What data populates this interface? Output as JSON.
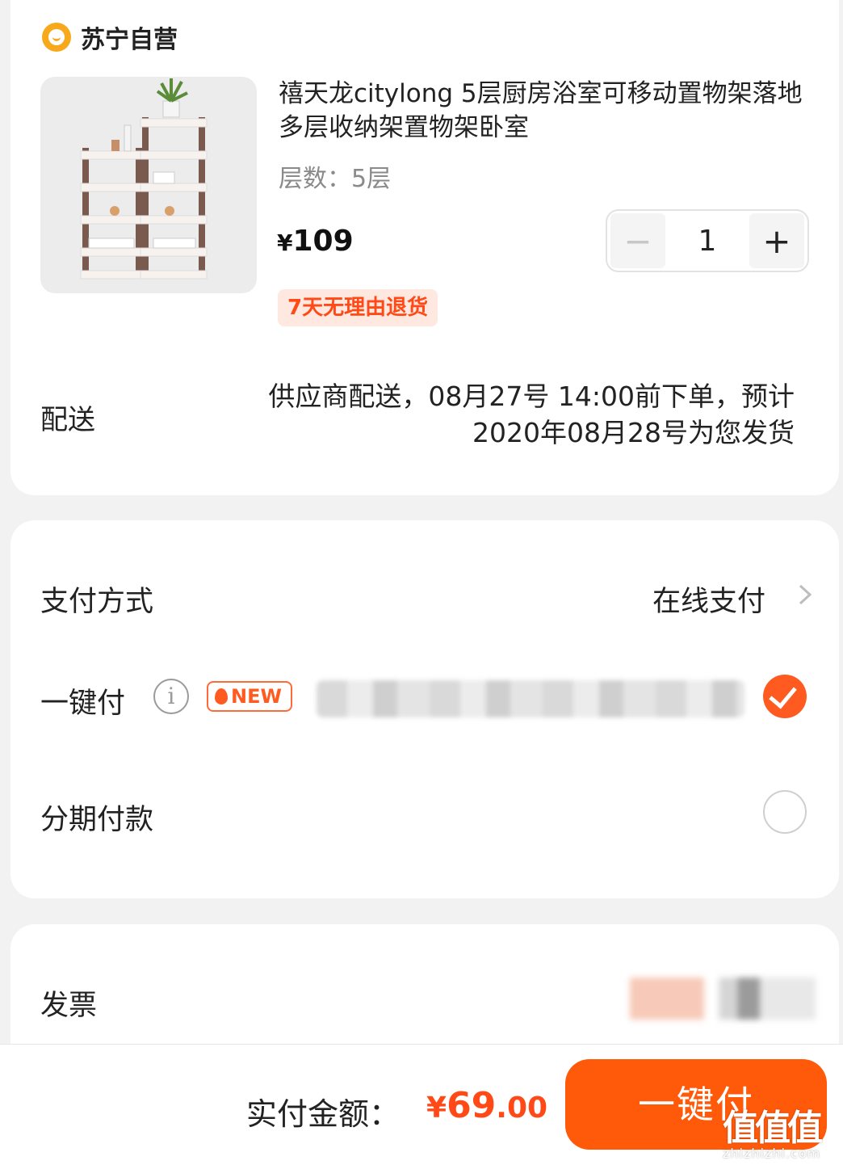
{
  "store": {
    "name": "苏宁自营",
    "logo_icon": "lion-logo-icon"
  },
  "product": {
    "title": "禧天龙citylong 5层厨房浴室可移动置物架落地多层收纳架置物架卧室",
    "spec": "层数：5层",
    "price_symbol": "¥",
    "price": "109",
    "quantity": "1",
    "minus_label": "−",
    "plus_label": "+",
    "return_tag": "7天无理由退货"
  },
  "shipping": {
    "label": "配送",
    "line1": "供应商配送，08月27号 14:00前下单，预计",
    "line2": "2020年08月28号为您发货"
  },
  "payment": {
    "method_label": "支付方式",
    "method_value": "在线支付",
    "onekey_label": "一键付",
    "new_badge": "NEW",
    "onekey_selected": true,
    "installment_label": "分期付款",
    "installment_selected": false
  },
  "invoice": {
    "label": "发票"
  },
  "footer": {
    "total_label": "实付金额：",
    "total_symbol": "¥",
    "total_int": "69",
    "total_dec": ".00",
    "pay_button": "一键付"
  },
  "watermark": {
    "big": "值值值",
    "small": "zhizhizhi.com"
  },
  "colors": {
    "accent": "#ff5a0a",
    "price_red": "#ff4a18",
    "tag_bg": "#ffe8e0",
    "store_logo": "#f7a81b"
  }
}
